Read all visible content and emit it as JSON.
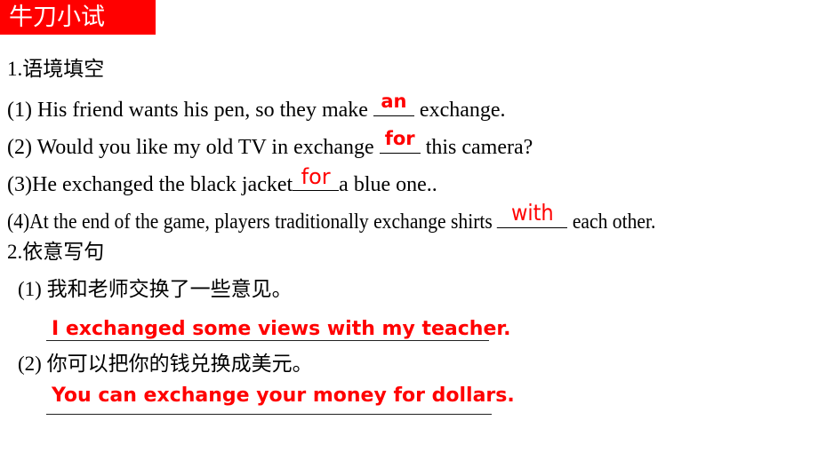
{
  "banner": {
    "title": "牛刀小试",
    "background": "#FF0000",
    "text_color": "#FFFFFF"
  },
  "colors": {
    "answer_red": "#FF0000",
    "body_text": "#000000",
    "page_background": "#FFFFFF"
  },
  "section1": {
    "heading": "1.语境填空",
    "items": [
      {
        "prefix": "(1) ",
        "text_before": "His friend wants his pen, so they make ",
        "blank_answer": "an",
        "text_after": " exchange."
      },
      {
        "prefix": "(2) ",
        "text_before": "Would you like my old TV in exchange ",
        "blank_answer": "for",
        "text_after": " this camera?"
      },
      {
        "prefix": "(3)",
        "text_before": "He exchanged the black jacket",
        "blank_answer": "for",
        "text_after": "a blue one.."
      },
      {
        "prefix": "(4)",
        "text_before": "At the end of the game, players traditionally exchange shirts ",
        "blank_answer": "with",
        "text_after": " each other."
      }
    ]
  },
  "section2": {
    "heading": "2.依意写句",
    "items": [
      {
        "prompt": "(1) 我和老师交换了一些意见。",
        "answer": "I exchanged some views with my teacher."
      },
      {
        "prompt": "(2) 你可以把你的钱兑换成美元。",
        "answer": "You can exchange your money for dollars."
      }
    ]
  }
}
